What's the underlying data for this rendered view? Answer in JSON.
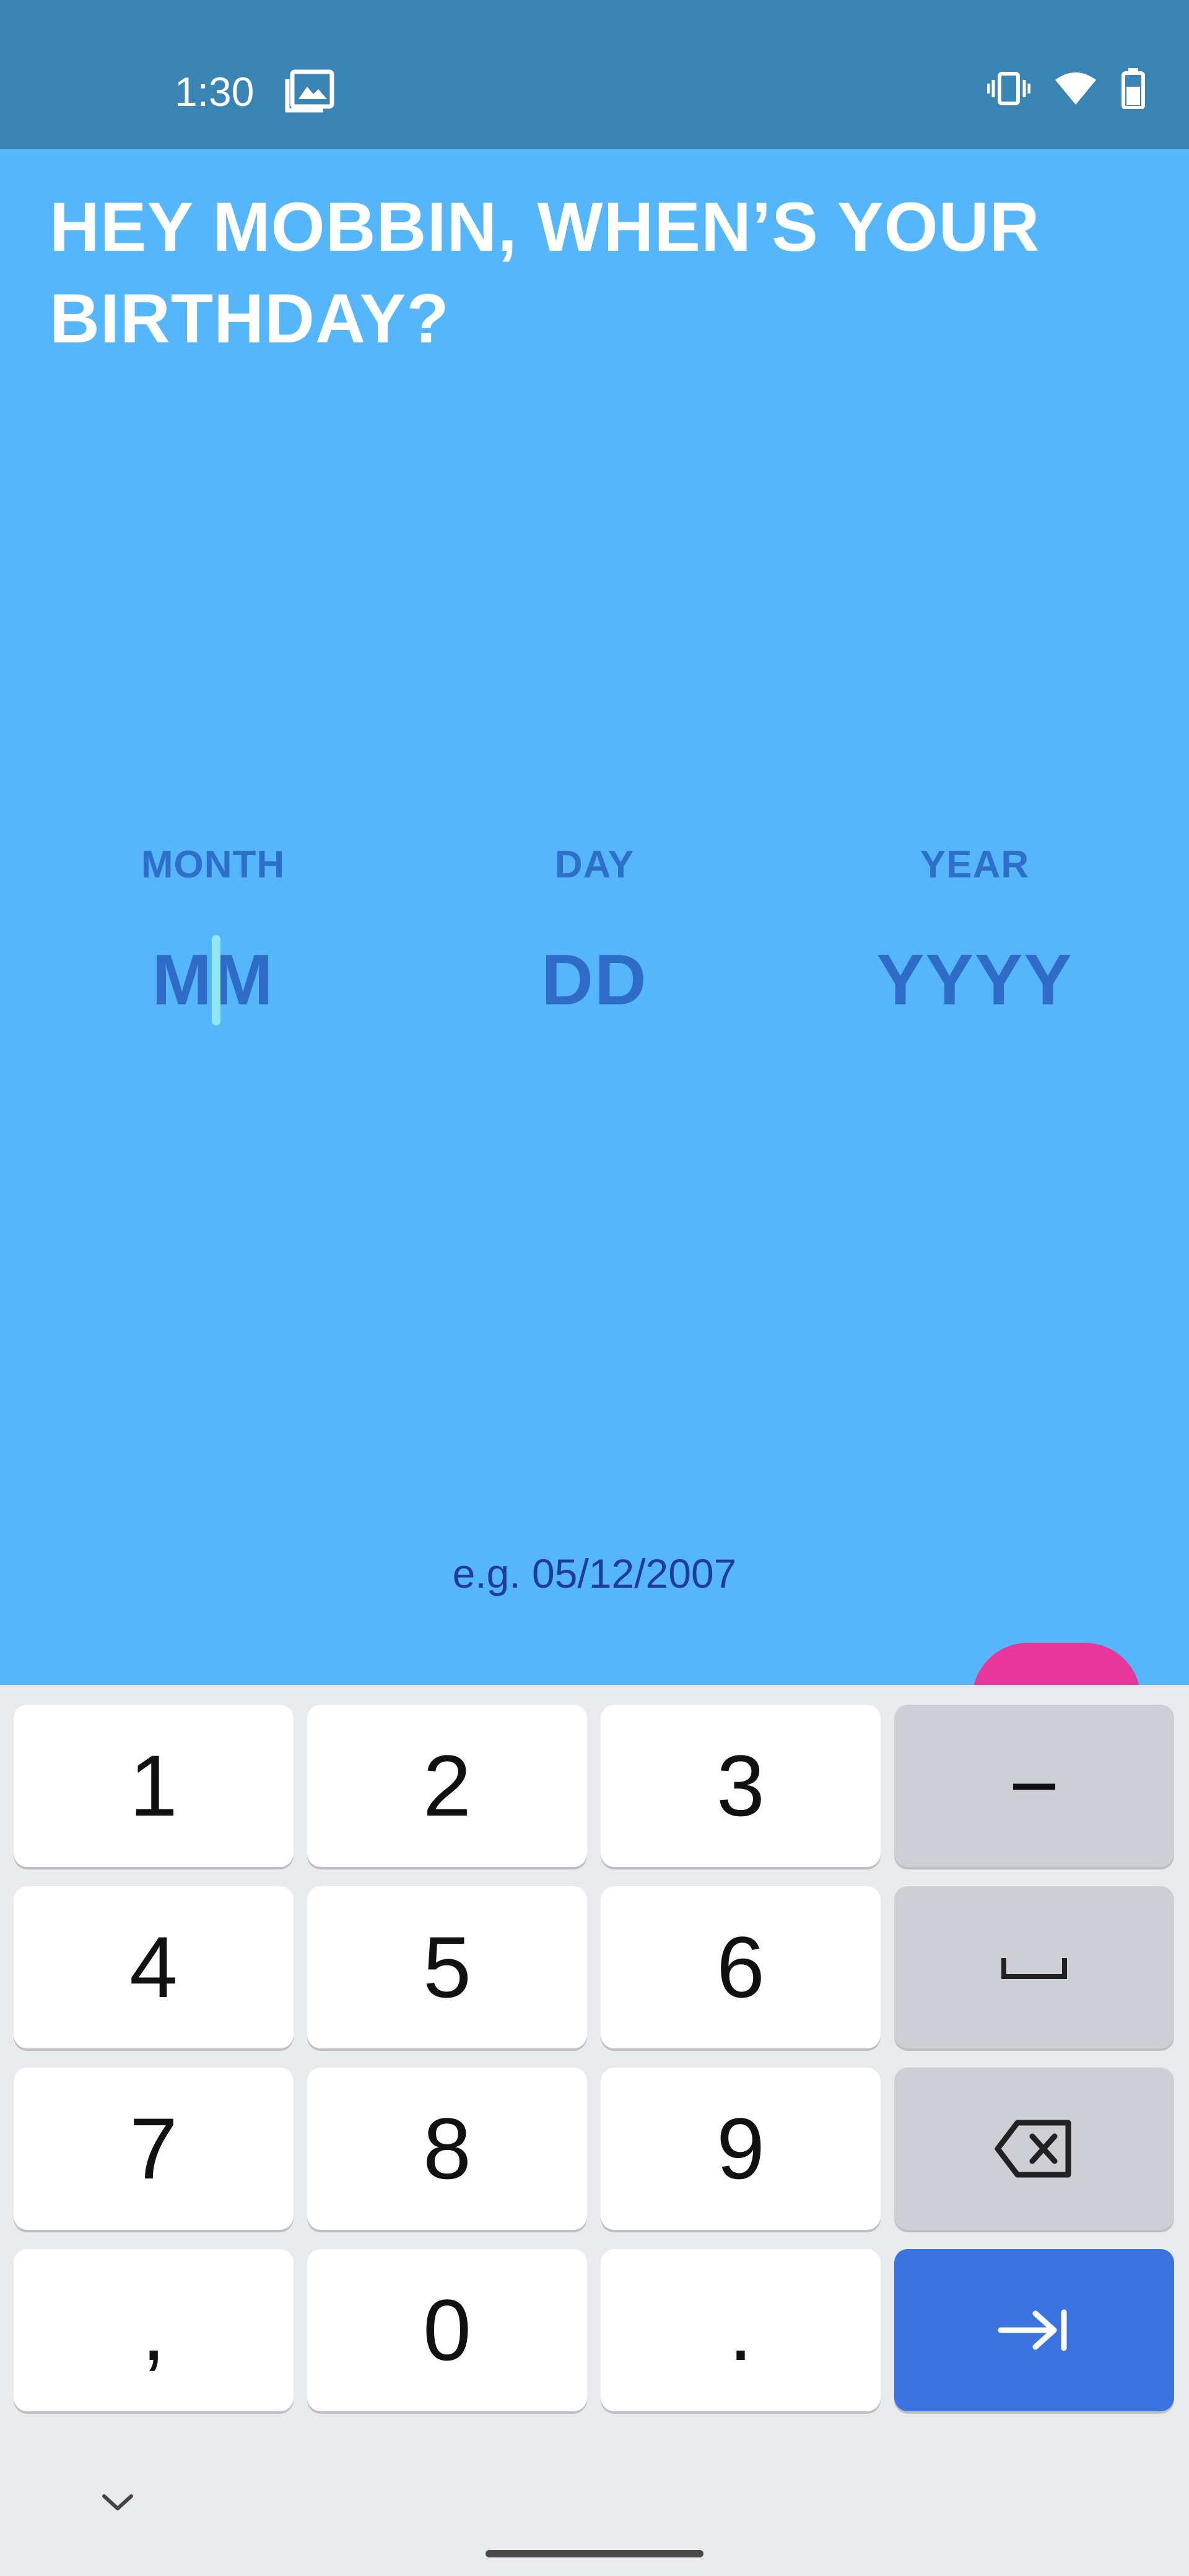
{
  "status_bar": {
    "time": "1:30",
    "icons": [
      "gallery-icon",
      "vibrate-icon",
      "wifi-icon",
      "battery-icon"
    ]
  },
  "headline": {
    "line1": "HEY MOBBIN, WHEN’S YOUR",
    "line2": "BIRTHDAY?"
  },
  "fields": {
    "month": {
      "label": "MONTH",
      "placeholder": "MM"
    },
    "day": {
      "label": "DAY",
      "placeholder": "DD"
    },
    "year": {
      "label": "YEAR",
      "placeholder": "YYYY"
    }
  },
  "hint": "e.g. 05/12/2007",
  "next_button": {
    "icon": "arrow-right-icon"
  },
  "keyboard": {
    "row1": [
      "1",
      "2",
      "3",
      "−"
    ],
    "row2": [
      "4",
      "5",
      "6",
      "space-icon"
    ],
    "row3": [
      "7",
      "8",
      "9",
      "backspace-icon"
    ],
    "row4": [
      ",",
      "0",
      ".",
      "tab-next-icon"
    ],
    "collapse_icon": "chevron-down-icon"
  },
  "colors": {
    "background": "#55b6fb",
    "status_bar": "#3a84b4",
    "accent_button": "#e8369b",
    "field_text": "#2f6cc9",
    "keyboard_action": "#3b74de"
  }
}
